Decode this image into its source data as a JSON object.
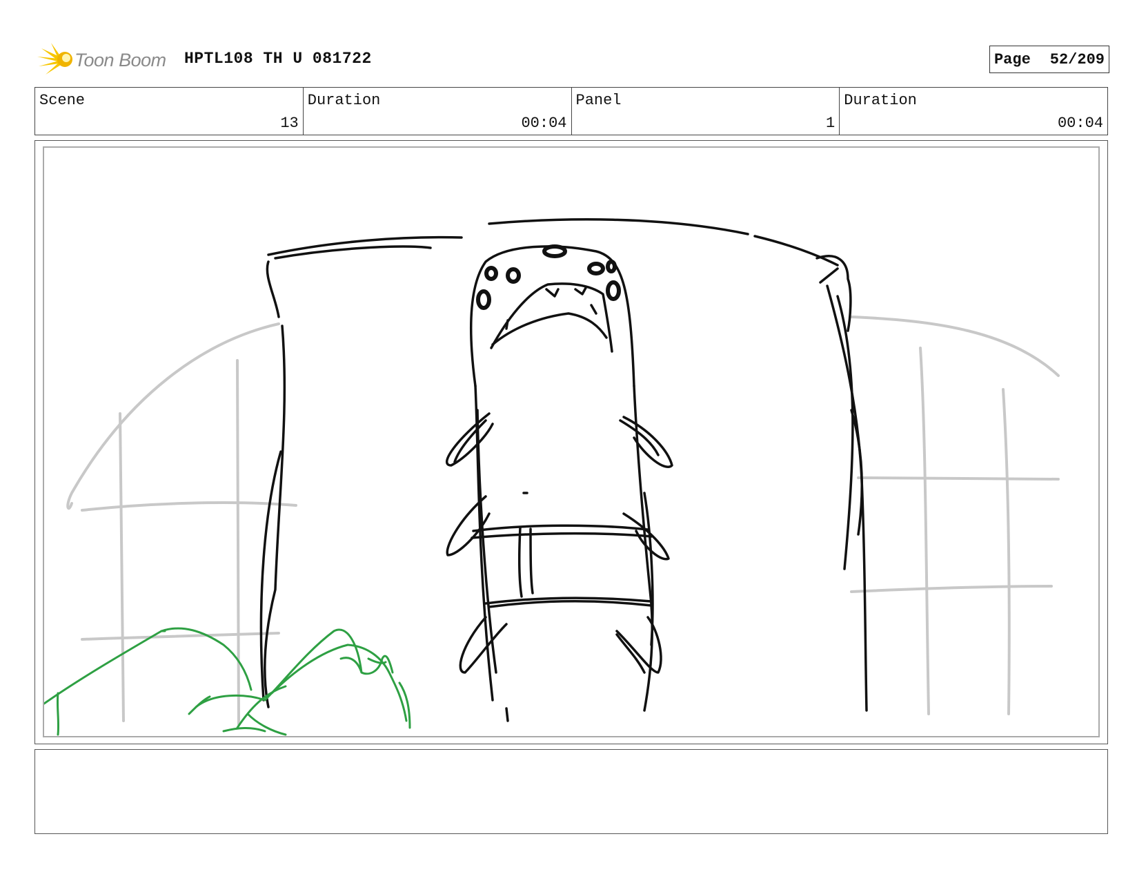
{
  "header": {
    "logo_text": "Toon Boom",
    "doc_title": "HPTL108 TH U 081722",
    "page_label": "Page",
    "page_value": "52/209"
  },
  "info": [
    {
      "label": "Scene",
      "value": "13"
    },
    {
      "label": "Duration",
      "value": "00:04"
    },
    {
      "label": "Panel",
      "value": "1"
    },
    {
      "label": "Duration",
      "value": "00:04"
    }
  ],
  "notes": {
    "text": ""
  },
  "colors": {
    "logo_yellow": "#f7c600",
    "sketch_black": "#111111",
    "sketch_grey": "#c8c8c8",
    "sketch_green": "#2ea043"
  },
  "icons": {
    "logo": "starburst-icon"
  }
}
